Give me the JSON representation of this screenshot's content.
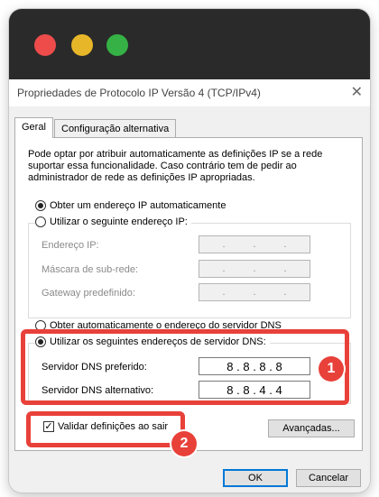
{
  "window": {
    "title": "Propriedades de Protocolo IP Versão 4 (TCP/IPv4)",
    "close_glyph": "✕"
  },
  "tabs": [
    {
      "label": "Geral",
      "active": true
    },
    {
      "label": "Configuração alternativa",
      "active": false
    }
  ],
  "intro_text": "Pode optar por atribuir automaticamente as definições IP se a rede suportar essa funcionalidade. Caso contrário tem de pedir ao administrador de rede as definições IP apropriadas.",
  "ip_section": {
    "auto_option": "Obter um endereço IP automaticamente",
    "auto_selected": true,
    "manual_option": "Utilizar o seguinte endereço IP:",
    "fields": [
      {
        "label": "Endereço IP:",
        "octets": [
          ".",
          ".",
          "."
        ]
      },
      {
        "label": "Máscara de sub-rede:",
        "octets": [
          ".",
          ".",
          "."
        ]
      },
      {
        "label": "Gateway predefinido:",
        "octets": [
          ".",
          ".",
          "."
        ]
      }
    ]
  },
  "dns_section": {
    "auto_option": "Obter automaticamente o endereço do servidor DNS",
    "manual_option": "Utilizar os seguintes endereços de servidor DNS:",
    "manual_selected": true,
    "preferred_label": "Servidor DNS preferido:",
    "preferred_value": "8 . 8 . 8 . 8",
    "alternate_label": "Servidor DNS alternativo:",
    "alternate_value": "8 . 8 . 4 . 4"
  },
  "validate": {
    "label": "Validar definições ao sair",
    "checked": true,
    "check_glyph": "✓"
  },
  "buttons": {
    "advanced": "Avançadas...",
    "ok": "OK",
    "cancel": "Cancelar"
  },
  "annotations": {
    "badge1": "1",
    "badge2": "2",
    "color": "#e8413a"
  }
}
